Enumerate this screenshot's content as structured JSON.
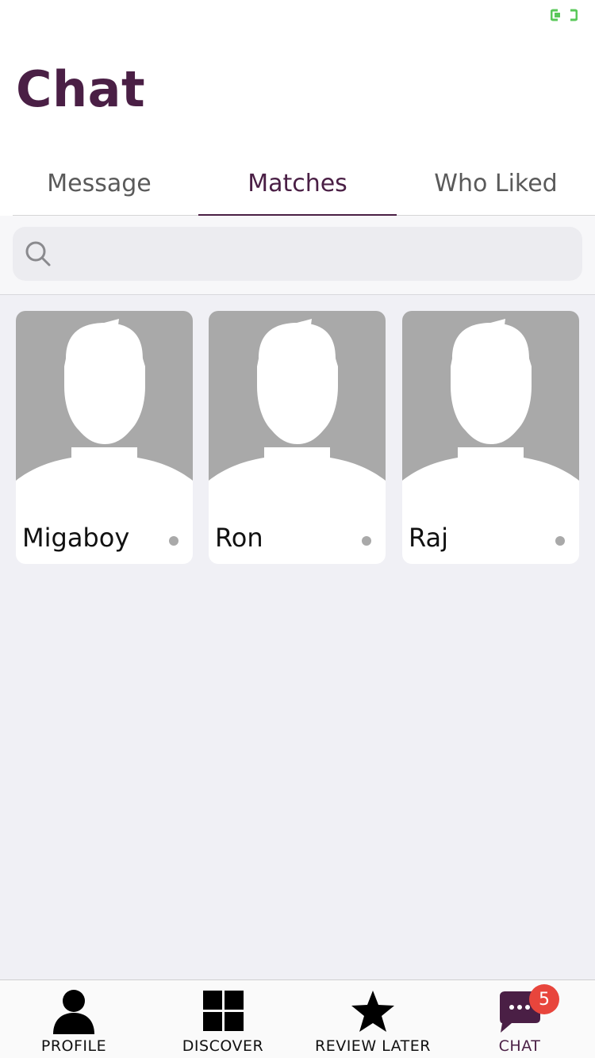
{
  "title": "Chat",
  "tabs": [
    {
      "label": "Message"
    },
    {
      "label": "Matches"
    },
    {
      "label": "Who Liked"
    }
  ],
  "active_tab_index": 1,
  "search": {
    "placeholder": "",
    "value": ""
  },
  "matches": [
    {
      "name": "Migaboy",
      "status": "offline"
    },
    {
      "name": "Ron",
      "status": "offline"
    },
    {
      "name": "Raj",
      "status": "offline"
    }
  ],
  "tabbar": {
    "items": [
      {
        "label": "PROFILE",
        "icon": "person-icon"
      },
      {
        "label": "DISCOVER",
        "icon": "grid-icon"
      },
      {
        "label": "REVIEW LATER",
        "icon": "star-icon"
      },
      {
        "label": "CHAT",
        "icon": "chat-bubble-icon",
        "badge": "5"
      }
    ],
    "active_index": 3
  },
  "colors": {
    "accent": "#4a1f45",
    "badge": "#e8453c",
    "placeholder_gray": "#a9a9a9",
    "background": "#f0f0f5"
  },
  "status_bar": {
    "icon": "battery-icon",
    "color": "#5ac85a"
  }
}
